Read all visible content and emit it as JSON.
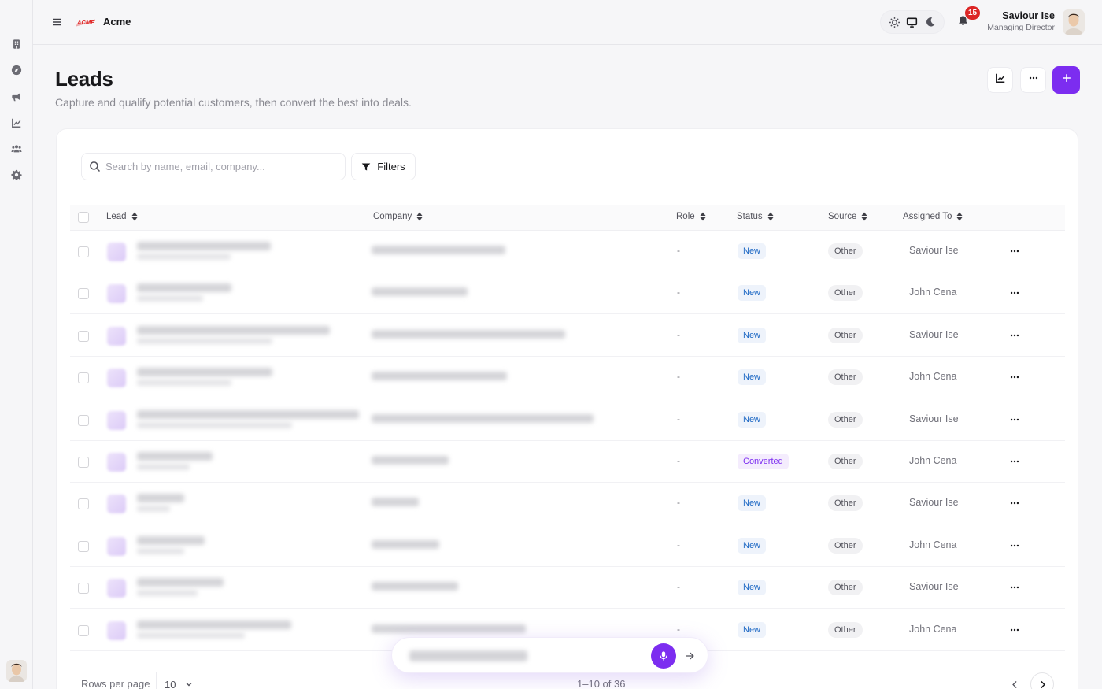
{
  "app": {
    "name": "Acme",
    "logo_text": "ACME"
  },
  "header": {
    "notifications_count": "15",
    "user_name": "Saviour Ise",
    "user_role": "Managing Director"
  },
  "sidebar": {
    "items": [
      {
        "icon": "building-icon"
      },
      {
        "icon": "compass-icon"
      },
      {
        "icon": "megaphone-icon"
      },
      {
        "icon": "chart-line-icon"
      },
      {
        "icon": "users-icon"
      },
      {
        "icon": "gear-icon"
      }
    ]
  },
  "page": {
    "title": "Leads",
    "subtitle": "Capture and qualify potential customers, then convert the best into deals."
  },
  "toolbar": {
    "search_placeholder": "Search by name, email, company...",
    "filters_label": "Filters"
  },
  "table": {
    "columns": [
      "Lead",
      "Company",
      "Role",
      "Status",
      "Source",
      "Assigned To"
    ],
    "rows": [
      {
        "role": "-",
        "status": "New",
        "status_kind": "new",
        "source": "Other",
        "assigned_to": "Saviour Ise"
      },
      {
        "role": "-",
        "status": "New",
        "status_kind": "new",
        "source": "Other",
        "assigned_to": "John Cena"
      },
      {
        "role": "-",
        "status": "New",
        "status_kind": "new",
        "source": "Other",
        "assigned_to": "Saviour Ise"
      },
      {
        "role": "-",
        "status": "New",
        "status_kind": "new",
        "source": "Other",
        "assigned_to": "John Cena"
      },
      {
        "role": "-",
        "status": "New",
        "status_kind": "new",
        "source": "Other",
        "assigned_to": "Saviour Ise"
      },
      {
        "role": "-",
        "status": "Converted",
        "status_kind": "converted",
        "source": "Other",
        "assigned_to": "John Cena"
      },
      {
        "role": "-",
        "status": "New",
        "status_kind": "new",
        "source": "Other",
        "assigned_to": "Saviour Ise"
      },
      {
        "role": "-",
        "status": "New",
        "status_kind": "new",
        "source": "Other",
        "assigned_to": "John Cena"
      },
      {
        "role": "-",
        "status": "New",
        "status_kind": "new",
        "source": "Other",
        "assigned_to": "Saviour Ise"
      },
      {
        "role": "-",
        "status": "New",
        "status_kind": "new",
        "source": "Other",
        "assigned_to": "John Cena"
      }
    ]
  },
  "pagination": {
    "rows_per_page_label": "Rows per page",
    "rows_per_page_value": "10",
    "range_text": "1–10 of 36"
  },
  "colors": {
    "accent": "#7c2df0",
    "badge": "#dc2626",
    "status_new": "#1d68c4",
    "status_converted": "#7c2df0"
  }
}
